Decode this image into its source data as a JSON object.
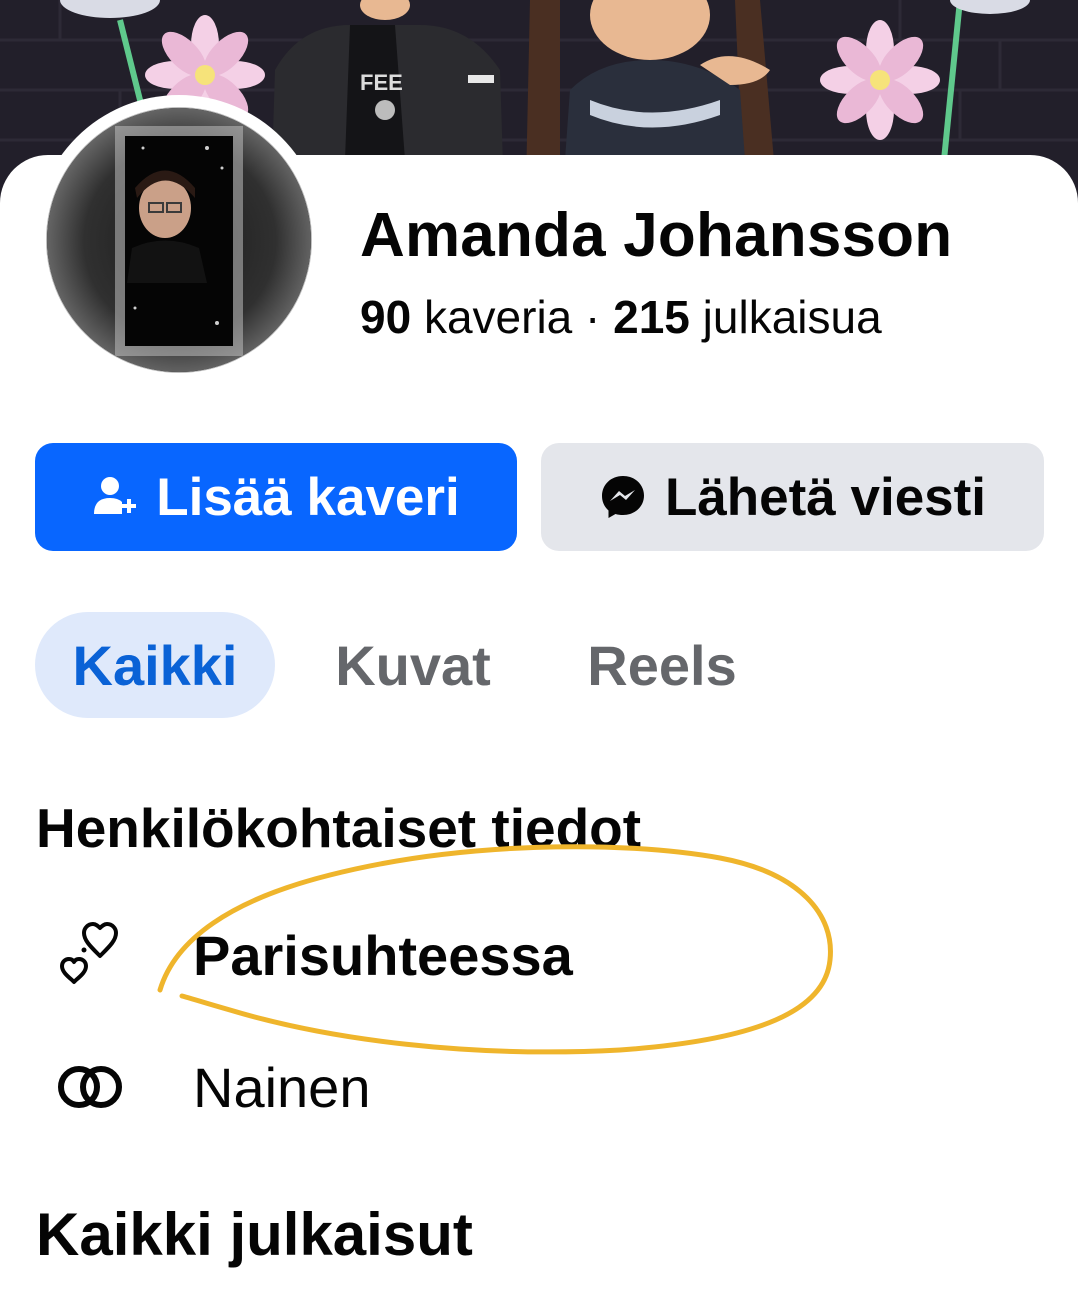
{
  "profile": {
    "name": "Amanda Johansson",
    "friends_count": "90",
    "friends_label": "kaveria",
    "separator": "·",
    "posts_count": "215",
    "posts_label": "julkaisua"
  },
  "actions": {
    "add_friend_label": "Lisää kaveri",
    "send_message_label": "Lähetä viesti"
  },
  "tabs": [
    {
      "label": "Kaikki",
      "selected": true
    },
    {
      "label": "Kuvat",
      "selected": false
    },
    {
      "label": "Reels",
      "selected": false
    }
  ],
  "personal_info": {
    "title": "Henkilökohtaiset tiedot",
    "items": [
      {
        "icon": "hearts-icon",
        "label": "Parisuhteessa"
      },
      {
        "icon": "gender-icon",
        "label": "Nainen"
      }
    ]
  },
  "posts_section": {
    "title": "Kaikki julkaisut"
  },
  "colors": {
    "primary_blue": "#0866ff",
    "tab_selected_bg": "#dfe9fb",
    "tab_selected_text": "#0a62d6",
    "secondary_button": "#e4e6eb",
    "annotation_circle": "#efb52c"
  }
}
